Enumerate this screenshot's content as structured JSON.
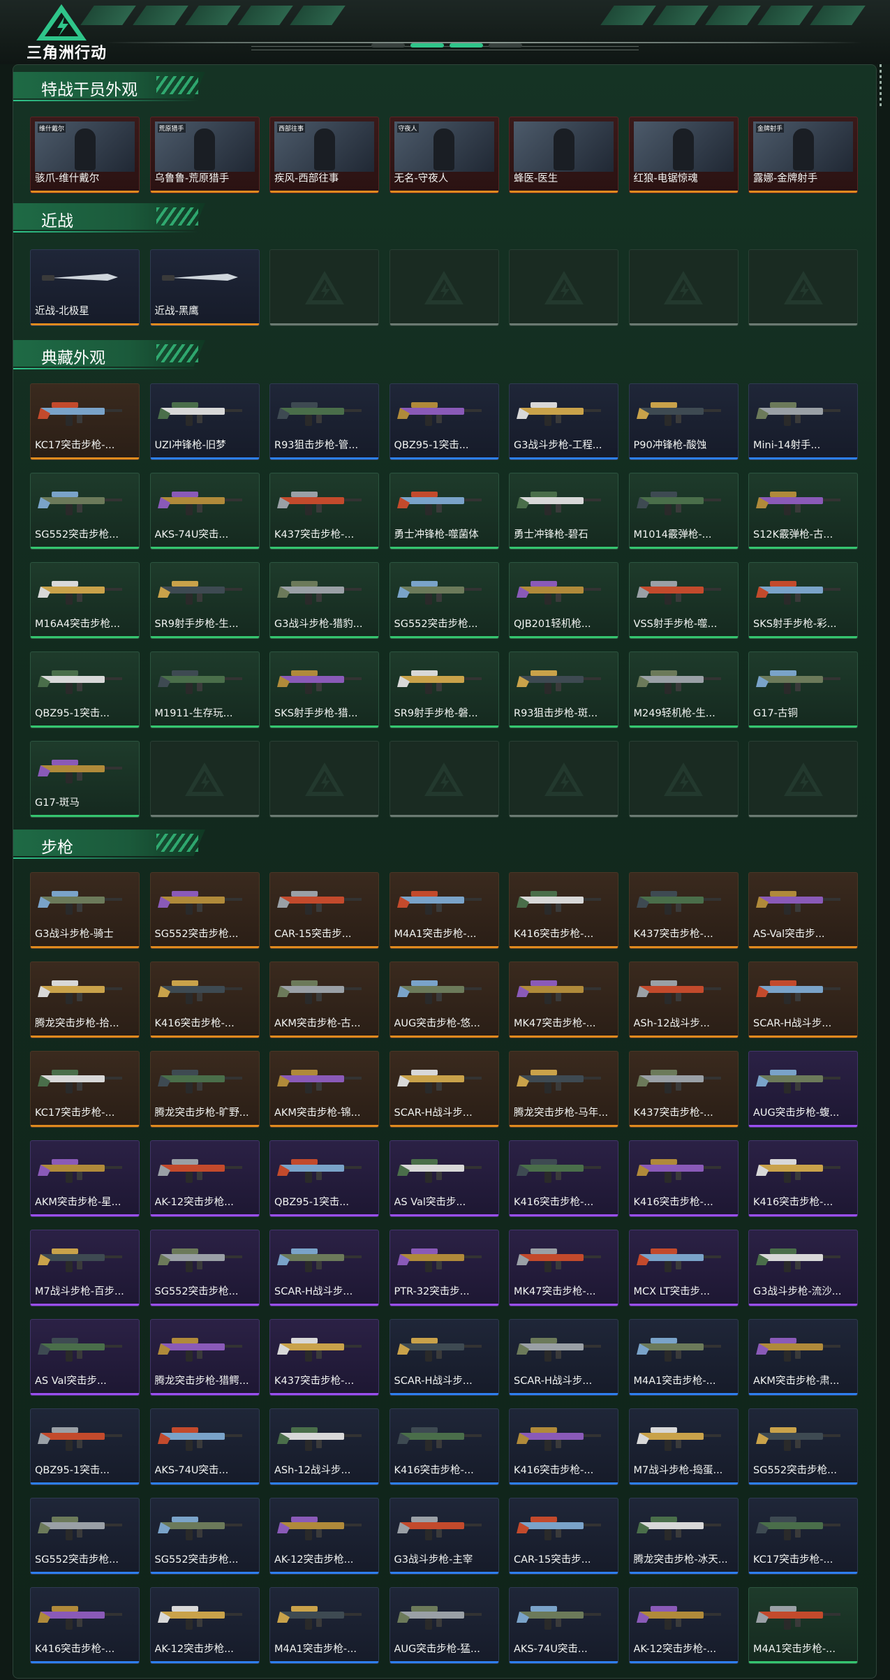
{
  "app": {
    "title": "三角洲行动"
  },
  "colors": {
    "orange": "#e08a1e",
    "green": "#35c56f",
    "blue": "#2d7ff0",
    "purple": "#9a4ff0",
    "accent": "#2fc58a"
  },
  "sections": [
    {
      "title": "特战干员外观",
      "rarity": "orange",
      "items": [
        {
          "name": "骇爪-维什戴尔",
          "tag": "维什戴尔"
        },
        {
          "name": "乌鲁鲁-荒原猎手",
          "tag": "荒原猎手"
        },
        {
          "name": "疾风-西部往事",
          "tag": "西部往事"
        },
        {
          "name": "无名-守夜人",
          "tag": "守夜人"
        },
        {
          "name": "蜂医-医生",
          "tag": ""
        },
        {
          "name": "红狼-电锯惊魂",
          "tag": ""
        },
        {
          "name": "露娜-金牌射手",
          "tag": "金牌射手"
        }
      ]
    },
    {
      "title": "近战",
      "rarity": "orange",
      "items": [
        {
          "name": "近战-北极星"
        },
        {
          "name": "近战-黑鹰"
        }
      ],
      "empty": 5
    },
    {
      "title": "典藏外观",
      "items": [
        {
          "name": "KC17突击步枪-...",
          "r": "orange"
        },
        {
          "name": "UZI冲锋枪-旧梦",
          "r": "blue"
        },
        {
          "name": "R93狙击步枪-管...",
          "r": "blue"
        },
        {
          "name": "QBZ95-1突击...",
          "r": "blue"
        },
        {
          "name": "G3战斗步枪-工程...",
          "r": "blue"
        },
        {
          "name": "P90冲锋枪-酸蚀",
          "r": "blue"
        },
        {
          "name": "Mini-14射手...",
          "r": "blue"
        },
        {
          "name": "SG552突击步枪...",
          "r": "green"
        },
        {
          "name": "AKS-74U突击...",
          "r": "green"
        },
        {
          "name": "K437突击步枪-...",
          "r": "green"
        },
        {
          "name": "勇士冲锋枪-噬菌体",
          "r": "green"
        },
        {
          "name": "勇士冲锋枪-碧石",
          "r": "green"
        },
        {
          "name": "M1014霰弹枪-...",
          "r": "green"
        },
        {
          "name": "S12K霰弹枪-古...",
          "r": "green"
        },
        {
          "name": "M16A4突击步枪...",
          "r": "green"
        },
        {
          "name": "SR9射手步枪-生...",
          "r": "green"
        },
        {
          "name": "G3战斗步枪-猎豹...",
          "r": "green"
        },
        {
          "name": "SG552突击步枪...",
          "r": "green"
        },
        {
          "name": "QJB201轻机枪...",
          "r": "green"
        },
        {
          "name": "VSS射手步枪-噬...",
          "r": "green"
        },
        {
          "name": "SKS射手步枪-彩...",
          "r": "green"
        },
        {
          "name": "QBZ95-1突击...",
          "r": "green"
        },
        {
          "name": "M1911-生存玩...",
          "r": "green"
        },
        {
          "name": "SKS射手步枪-猎...",
          "r": "green"
        },
        {
          "name": "SR9射手步枪-磐...",
          "r": "green"
        },
        {
          "name": "R93狙击步枪-斑...",
          "r": "green"
        },
        {
          "name": "M249轻机枪-生...",
          "r": "green"
        },
        {
          "name": "G17-古铜",
          "r": "green"
        },
        {
          "name": "G17-斑马",
          "r": "green"
        }
      ],
      "empty": 6
    },
    {
      "title": "步枪",
      "items": [
        {
          "name": "G3战斗步枪-骑士",
          "r": "orange"
        },
        {
          "name": "SG552突击步枪...",
          "r": "orange"
        },
        {
          "name": "CAR-15突击步...",
          "r": "orange"
        },
        {
          "name": "M4A1突击步枪-...",
          "r": "orange"
        },
        {
          "name": "K416突击步枪-...",
          "r": "orange"
        },
        {
          "name": "K437突击步枪-...",
          "r": "orange"
        },
        {
          "name": "AS-Val突击步...",
          "r": "orange"
        },
        {
          "name": "腾龙突击步枪-拾...",
          "r": "orange"
        },
        {
          "name": "K416突击步枪-...",
          "r": "orange"
        },
        {
          "name": "AKM突击步枪-古...",
          "r": "orange"
        },
        {
          "name": "AUG突击步枪-悠...",
          "r": "orange"
        },
        {
          "name": "MK47突击步枪-...",
          "r": "orange"
        },
        {
          "name": "ASh-12战斗步...",
          "r": "orange"
        },
        {
          "name": "SCAR-H战斗步...",
          "r": "orange"
        },
        {
          "name": "KC17突击步枪-...",
          "r": "orange"
        },
        {
          "name": "腾龙突击步枪-旷野...",
          "r": "orange"
        },
        {
          "name": "AKM突击步枪-锦...",
          "r": "orange"
        },
        {
          "name": "SCAR-H战斗步...",
          "r": "orange"
        },
        {
          "name": "腾龙突击步枪-马年...",
          "r": "orange"
        },
        {
          "name": "K437突击步枪-...",
          "r": "orange"
        },
        {
          "name": "AUG突击步枪-蝮...",
          "r": "purple"
        },
        {
          "name": "AKM突击步枪-星...",
          "r": "purple"
        },
        {
          "name": "AK-12突击步枪...",
          "r": "purple"
        },
        {
          "name": "QBZ95-1突击...",
          "r": "purple"
        },
        {
          "name": "AS Val突击步...",
          "r": "purple"
        },
        {
          "name": "K416突击步枪-...",
          "r": "purple"
        },
        {
          "name": "K416突击步枪-...",
          "r": "purple"
        },
        {
          "name": "K416突击步枪-...",
          "r": "purple"
        },
        {
          "name": "M7战斗步枪-百步...",
          "r": "purple"
        },
        {
          "name": "SG552突击步枪...",
          "r": "purple"
        },
        {
          "name": "SCAR-H战斗步...",
          "r": "purple"
        },
        {
          "name": "PTR-32突击步...",
          "r": "purple"
        },
        {
          "name": "MK47突击步枪-...",
          "r": "purple"
        },
        {
          "name": "MCX LT突击步...",
          "r": "purple"
        },
        {
          "name": "G3战斗步枪-流沙...",
          "r": "purple"
        },
        {
          "name": "AS Val突击步...",
          "r": "purple"
        },
        {
          "name": "腾龙突击步枪-猎鳄...",
          "r": "purple"
        },
        {
          "name": "K437突击步枪-...",
          "r": "purple"
        },
        {
          "name": "SCAR-H战斗步...",
          "r": "blue"
        },
        {
          "name": "SCAR-H战斗步...",
          "r": "blue"
        },
        {
          "name": "M4A1突击步枪-...",
          "r": "blue"
        },
        {
          "name": "AKM突击步枪-肃...",
          "r": "blue"
        },
        {
          "name": "QBZ95-1突击...",
          "r": "blue"
        },
        {
          "name": "AKS-74U突击...",
          "r": "blue"
        },
        {
          "name": "ASh-12战斗步...",
          "r": "blue"
        },
        {
          "name": "K416突击步枪-...",
          "r": "blue"
        },
        {
          "name": "K416突击步枪-...",
          "r": "blue"
        },
        {
          "name": "M7战斗步枪-捣蛋...",
          "r": "blue"
        },
        {
          "name": "SG552突击步枪...",
          "r": "blue"
        },
        {
          "name": "SG552突击步枪...",
          "r": "blue"
        },
        {
          "name": "SG552突击步枪...",
          "r": "blue"
        },
        {
          "name": "AK-12突击步枪...",
          "r": "blue"
        },
        {
          "name": "G3战斗步枪-主宰",
          "r": "blue"
        },
        {
          "name": "CAR-15突击步...",
          "r": "blue"
        },
        {
          "name": "腾龙突击步枪-冰天...",
          "r": "blue"
        },
        {
          "name": "KC17突击步枪-...",
          "r": "blue"
        },
        {
          "name": "K416突击步枪-...",
          "r": "blue"
        },
        {
          "name": "AK-12突击步枪...",
          "r": "blue"
        },
        {
          "name": "M4A1突击步枪-...",
          "r": "blue"
        },
        {
          "name": "AUG突击步枪-猛...",
          "r": "blue"
        },
        {
          "name": "AKS-74U突击...",
          "r": "blue"
        },
        {
          "name": "AK-12突击步枪-...",
          "r": "blue"
        },
        {
          "name": "M4A1突击步枪-...",
          "r": "green"
        }
      ]
    }
  ]
}
